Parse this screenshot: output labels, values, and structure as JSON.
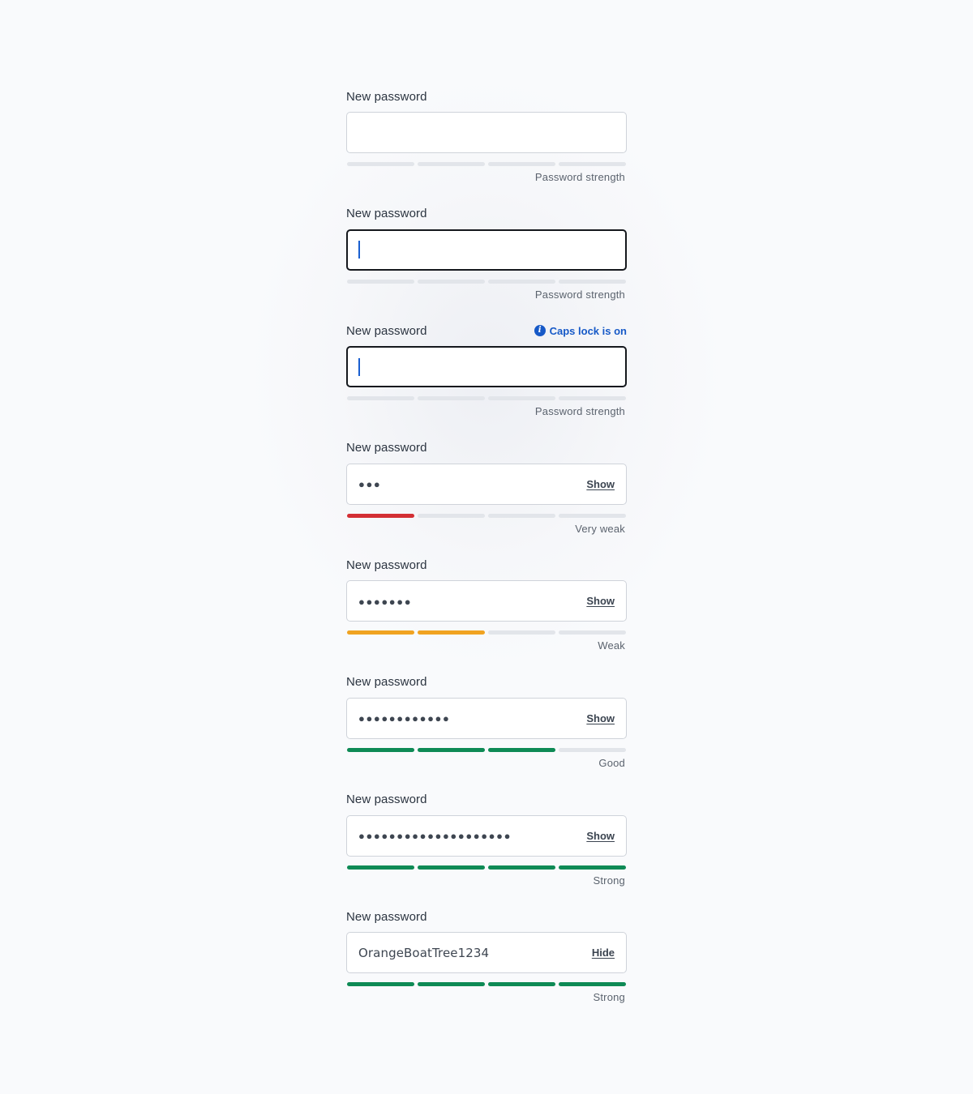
{
  "colors": {
    "empty_segment": "#e2e5ea",
    "very_weak": "#d32f34",
    "weak": "#f0a321",
    "good": "#0e8a55",
    "strong": "#0e8a55",
    "caps_lock": "#1659c7"
  },
  "fields": [
    {
      "label": "New password",
      "state": "empty",
      "value": "",
      "toggle": "",
      "strength_label": "Password strength",
      "strength_level": 0,
      "meter_color": "#e2e5ea",
      "caps_lock": ""
    },
    {
      "label": "New password",
      "state": "focused",
      "value": "",
      "toggle": "",
      "strength_label": "Password strength",
      "strength_level": 0,
      "meter_color": "#e2e5ea",
      "caps_lock": ""
    },
    {
      "label": "New password",
      "state": "focused",
      "value": "",
      "toggle": "",
      "strength_label": "Password strength",
      "strength_level": 0,
      "meter_color": "#e2e5ea",
      "caps_lock": "Caps lock is on",
      "caps_lock_icon": "info-icon"
    },
    {
      "label": "New password",
      "state": "masked",
      "value": "●●●",
      "toggle": "Show",
      "strength_label": "Very weak",
      "strength_level": 1,
      "meter_color": "#d32f34",
      "caps_lock": ""
    },
    {
      "label": "New password",
      "state": "masked",
      "value": "●●●●●●●",
      "toggle": "Show",
      "strength_label": "Weak",
      "strength_level": 2,
      "meter_color": "#f0a321",
      "caps_lock": ""
    },
    {
      "label": "New password",
      "state": "masked",
      "value": "●●●●●●●●●●●●",
      "toggle": "Show",
      "strength_label": "Good",
      "strength_level": 3,
      "meter_color": "#0e8a55",
      "caps_lock": ""
    },
    {
      "label": "New password",
      "state": "masked",
      "value": "●●●●●●●●●●●●●●●●●●●●",
      "toggle": "Show",
      "strength_label": "Strong",
      "strength_level": 4,
      "meter_color": "#0e8a55",
      "caps_lock": ""
    },
    {
      "label": "New password",
      "state": "revealed",
      "value": "OrangeBoatTree1234",
      "toggle": "Hide",
      "strength_label": "Strong",
      "strength_level": 4,
      "meter_color": "#0e8a55",
      "caps_lock": ""
    }
  ]
}
